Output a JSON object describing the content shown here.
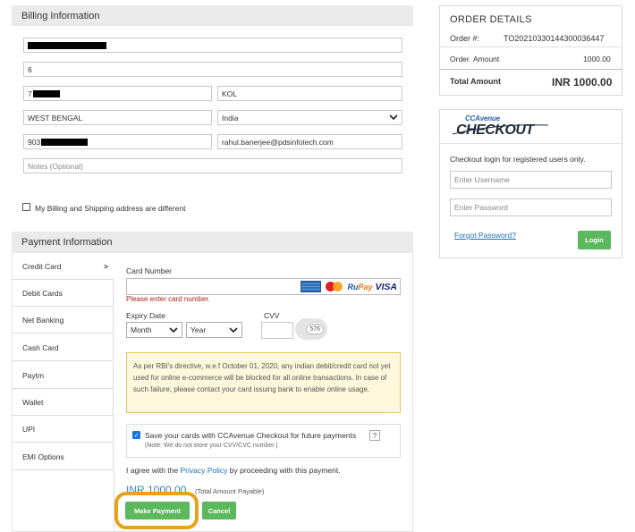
{
  "billing": {
    "title": "Billing Information",
    "line2": "6",
    "city": "KOL",
    "state": "WEST BENGAL",
    "country": "India",
    "email": "rahul.banerjee@pdsinfotech.com",
    "notes_placeholder": "Notes (Optional)",
    "pin_prefix": "7",
    "phone_prefix": "903",
    "shipping_diff_label": "My Billing and Shipping address are different"
  },
  "payment": {
    "title": "Payment Information",
    "tabs": [
      {
        "label": "Credit Card",
        "arrow": ">"
      },
      {
        "label": "Debit Cards"
      },
      {
        "label": "Net Banking"
      },
      {
        "label": "Cash Card"
      },
      {
        "label": "Paytm"
      },
      {
        "label": "Wallet"
      },
      {
        "label": "UPI"
      },
      {
        "label": "EMI Options"
      }
    ],
    "card_number_label": "Card Number",
    "card_error": "Please enter card number.",
    "card_brands": [
      "MasterCard",
      "RuPay",
      "VISA"
    ],
    "expiry_label": "Expiry Date",
    "month": "Month",
    "year": "Year",
    "cvv_label": "CVV",
    "cvv_sample": "576",
    "notice": "As per RBI's directive, w.e.f October 01, 2020, any indian debit/credit card not yet used for online e-commerce will be blocked for all online transactions. In case of such failure, please contact your card issuing bank to enable online usage.",
    "save_card_label": "Save your cards with CCAvenue Checkout for future payments",
    "save_card_help": "?",
    "save_card_note": "(Note: We do not store your CVV/CVC number.)",
    "agree_prefix": "I agree with the",
    "privacy_link": "Privacy Policy",
    "agree_suffix": "by proceeding with this payment.",
    "amount": "INR 1000.00",
    "amount_note": "(Total Amount Payable)",
    "make_payment": "Make Payment",
    "cancel": "Cancel"
  },
  "order": {
    "title": "ORDER DETAILS",
    "order_label": "Order #:",
    "order_number": "TO20210330144300036447",
    "amount_label": "Order  Amount",
    "amount_value": "1000.00",
    "total_label": "Total Amount",
    "total_value": "INR 1000.00"
  },
  "checkout": {
    "logo_top": "CCAvenue",
    "logo_main": "CHECKOUT",
    "login_text": "Checkout login for registered users only.",
    "username_placeholder": "Enter Username",
    "password_placeholder": "Enter Password",
    "forgot": "Forgot Password?",
    "login_button": "Login"
  },
  "colors": {
    "green": "#5cb85c",
    "link": "#1a6fb8",
    "error": "#b0201d",
    "notice_bg": "#fdf8dc",
    "notice_border": "#e3c65a",
    "highlight": "#e8a21a"
  }
}
